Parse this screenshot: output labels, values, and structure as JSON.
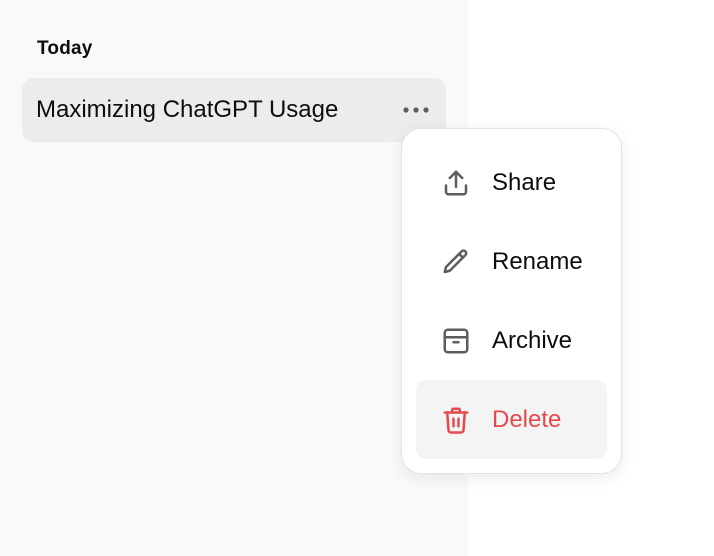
{
  "sidebar": {
    "section_heading": "Today",
    "chat_item": {
      "title": "Maximizing ChatGPT Usage"
    }
  },
  "context_menu": {
    "items": [
      {
        "label": "Share",
        "icon": "share-icon"
      },
      {
        "label": "Rename",
        "icon": "pencil-icon"
      },
      {
        "label": "Archive",
        "icon": "archive-icon"
      },
      {
        "label": "Delete",
        "icon": "trash-icon",
        "color": "#e5484d"
      }
    ]
  },
  "colors": {
    "sidebar_bg": "#f9f9f9",
    "selected_item_bg": "#ececec",
    "danger": "#e5484d"
  }
}
